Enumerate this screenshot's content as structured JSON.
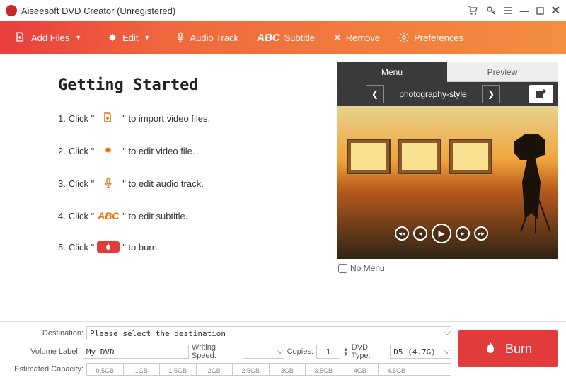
{
  "titlebar": {
    "title": "Aiseesoft DVD Creator (Unregistered)"
  },
  "toolbar": {
    "add_files": "Add Files",
    "edit": "Edit",
    "audio_track": "Audio Track",
    "subtitle": "Subtitle",
    "remove": "Remove",
    "preferences": "Preferences"
  },
  "getting_started": {
    "heading": "Getting Started",
    "steps": [
      {
        "n": "1.",
        "pre": "Click \"",
        "post": "\" to import video files."
      },
      {
        "n": "2.",
        "pre": "Click \"",
        "post": "\" to edit video file."
      },
      {
        "n": "3.",
        "pre": "Click \"",
        "post": "\" to edit audio track."
      },
      {
        "n": "4.",
        "pre": "Click \"",
        "post": "\" to edit subtitle."
      },
      {
        "n": "5.",
        "pre": "Click \"",
        "post": "\" to burn."
      }
    ],
    "abc_label": "ABC"
  },
  "right": {
    "tabs": {
      "menu": "Menu",
      "preview": "Preview"
    },
    "style_name": "photography-style",
    "no_menu": "No Menu"
  },
  "bottom": {
    "destination_label": "Destination:",
    "destination_value": "Please select the destination",
    "volume_label_label": "Volume Label:",
    "volume_label_value": "My DVD",
    "writing_speed_label": "Writing Speed:",
    "writing_speed_value": "",
    "copies_label": "Copies:",
    "copies_value": "1",
    "dvd_type_label": "DVD Type:",
    "dvd_type_value": "D5 (4.7G)",
    "capacity_label": "Estimated Capacity:",
    "ticks": [
      "0.5GB",
      "1GB",
      "1.5GB",
      "2GB",
      "2.5GB",
      "3GB",
      "3.5GB",
      "4GB",
      "4.5GB",
      ""
    ]
  },
  "burn_label": "Burn"
}
